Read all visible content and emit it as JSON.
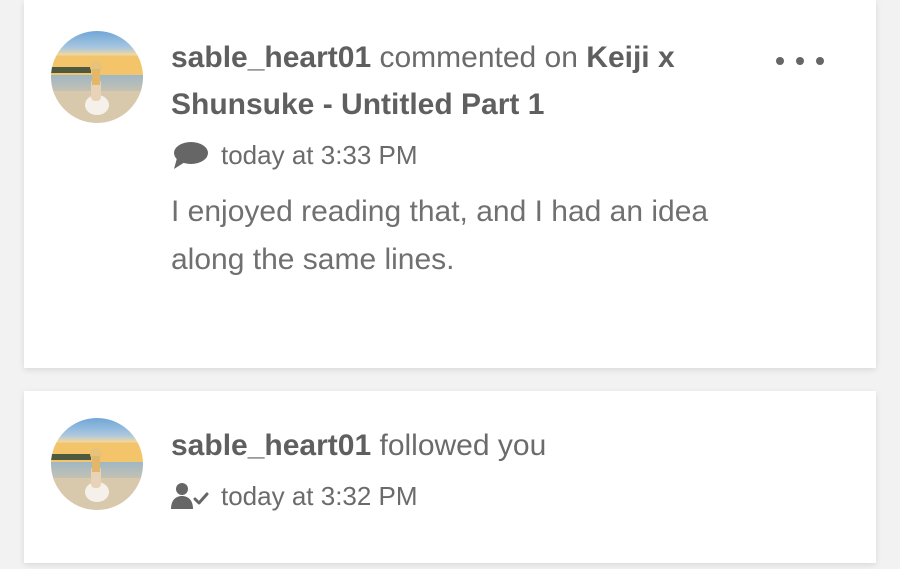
{
  "notifications": [
    {
      "username": "sable_heart01",
      "action": "commented on",
      "target": "Keiji x Shunsuke - Untitled Part 1",
      "icon": "comment-icon",
      "time": "today at 3:33 PM",
      "comment": "I enjoyed reading that, and I had an idea along the same lines."
    },
    {
      "username": "sable_heart01",
      "action": "followed you",
      "icon": "user-follow-icon",
      "time": "today at 3:32 PM"
    }
  ],
  "colors": {
    "text": "#6b6b6b",
    "card": "#ffffff",
    "background": "#f2f2f2"
  }
}
